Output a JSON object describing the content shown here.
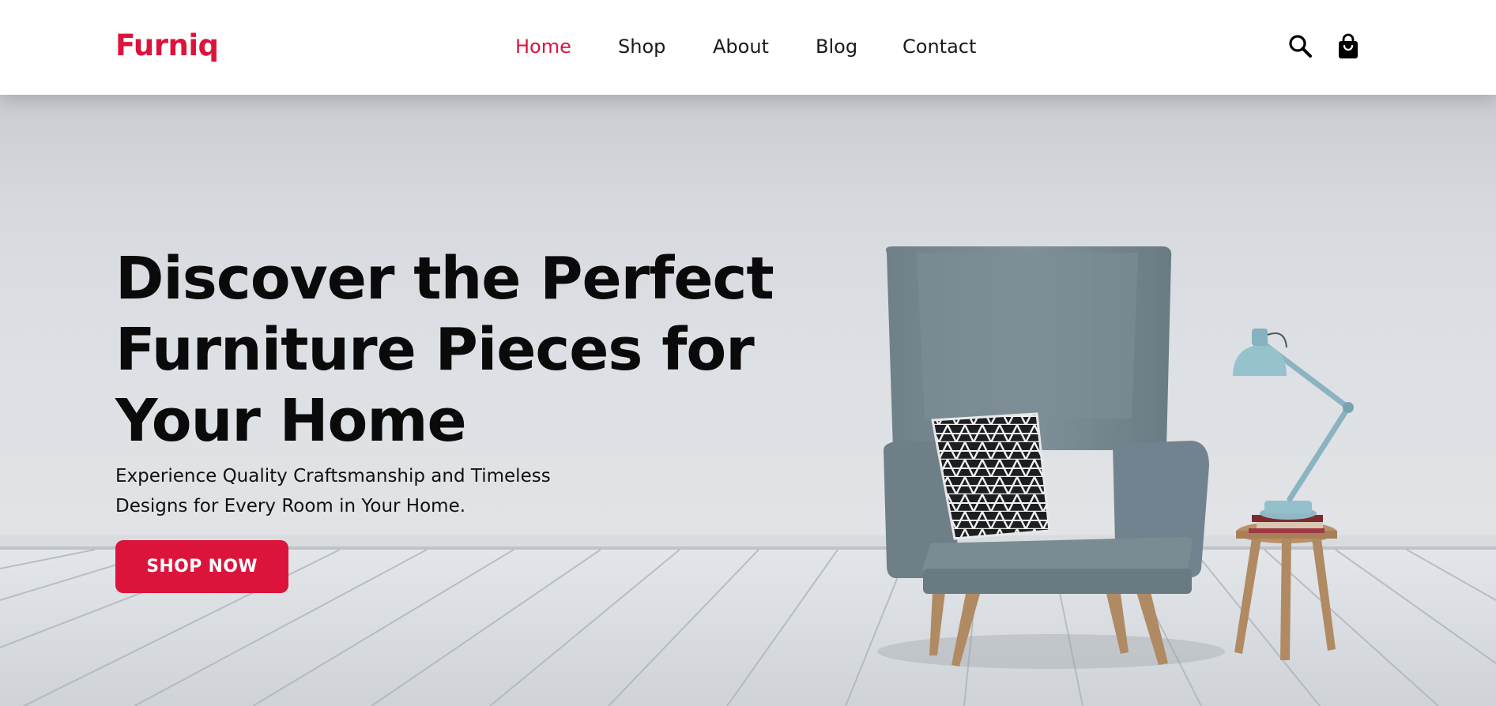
{
  "brand": {
    "logo": "Furniq",
    "accent_color": "#dc143c"
  },
  "nav": {
    "items": [
      {
        "label": "Home",
        "active": true
      },
      {
        "label": "Shop",
        "active": false
      },
      {
        "label": "About",
        "active": false
      },
      {
        "label": "Blog",
        "active": false
      },
      {
        "label": "Contact",
        "active": false
      }
    ]
  },
  "header_icons": {
    "search": "search-icon",
    "cart": "shopping-bag-icon"
  },
  "hero": {
    "headline_lines": [
      "Discover the Perfect",
      "Furniture Pieces for",
      "Your Home"
    ],
    "subtext_lines": [
      "Experience Quality Craftsmanship and Timeless",
      "Designs for Every Room in Your Home."
    ],
    "cta_label": "SHOP NOW"
  }
}
